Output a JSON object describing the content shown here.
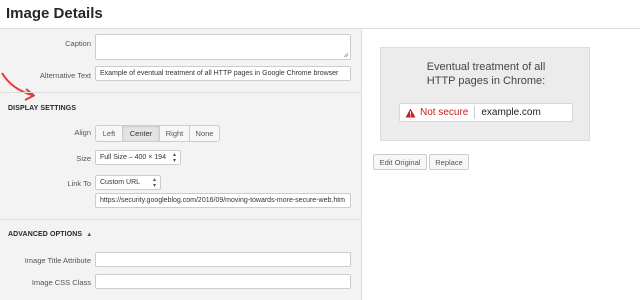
{
  "header": {
    "title": "Image Details"
  },
  "fields": {
    "caption_label": "Caption",
    "caption_value": "",
    "alt_label": "Alternative Text",
    "alt_value": "Example of eventual treatment of all HTTP pages in Google Chrome browser"
  },
  "display_settings": {
    "title": "DISPLAY SETTINGS",
    "align_label": "Align",
    "align_options": [
      "Left",
      "Center",
      "Right",
      "None"
    ],
    "align_selected": "Center",
    "size_label": "Size",
    "size_value": "Full Size – 400 × 194",
    "link_label": "Link To",
    "link_value": "Custom URL",
    "url_value": "https://security.googleblog.com/2016/09/moving-towards-more-secure-web.htm"
  },
  "advanced": {
    "title": "ADVANCED OPTIONS",
    "toggle_glyph": "▲",
    "title_attr_label": "Image Title Attribute",
    "title_attr_value": "",
    "css_class_label": "Image CSS Class",
    "css_class_value": ""
  },
  "preview": {
    "title_line1": "Eventual treatment of all",
    "title_line2": "HTTP pages in Chrome:",
    "not_secure": "Not secure",
    "url": "example.com",
    "warning_color": "#c5221f"
  },
  "actions": {
    "edit_original": "Edit Original",
    "replace": "Replace"
  },
  "annotation": {
    "arrow_color": "#e53935"
  }
}
